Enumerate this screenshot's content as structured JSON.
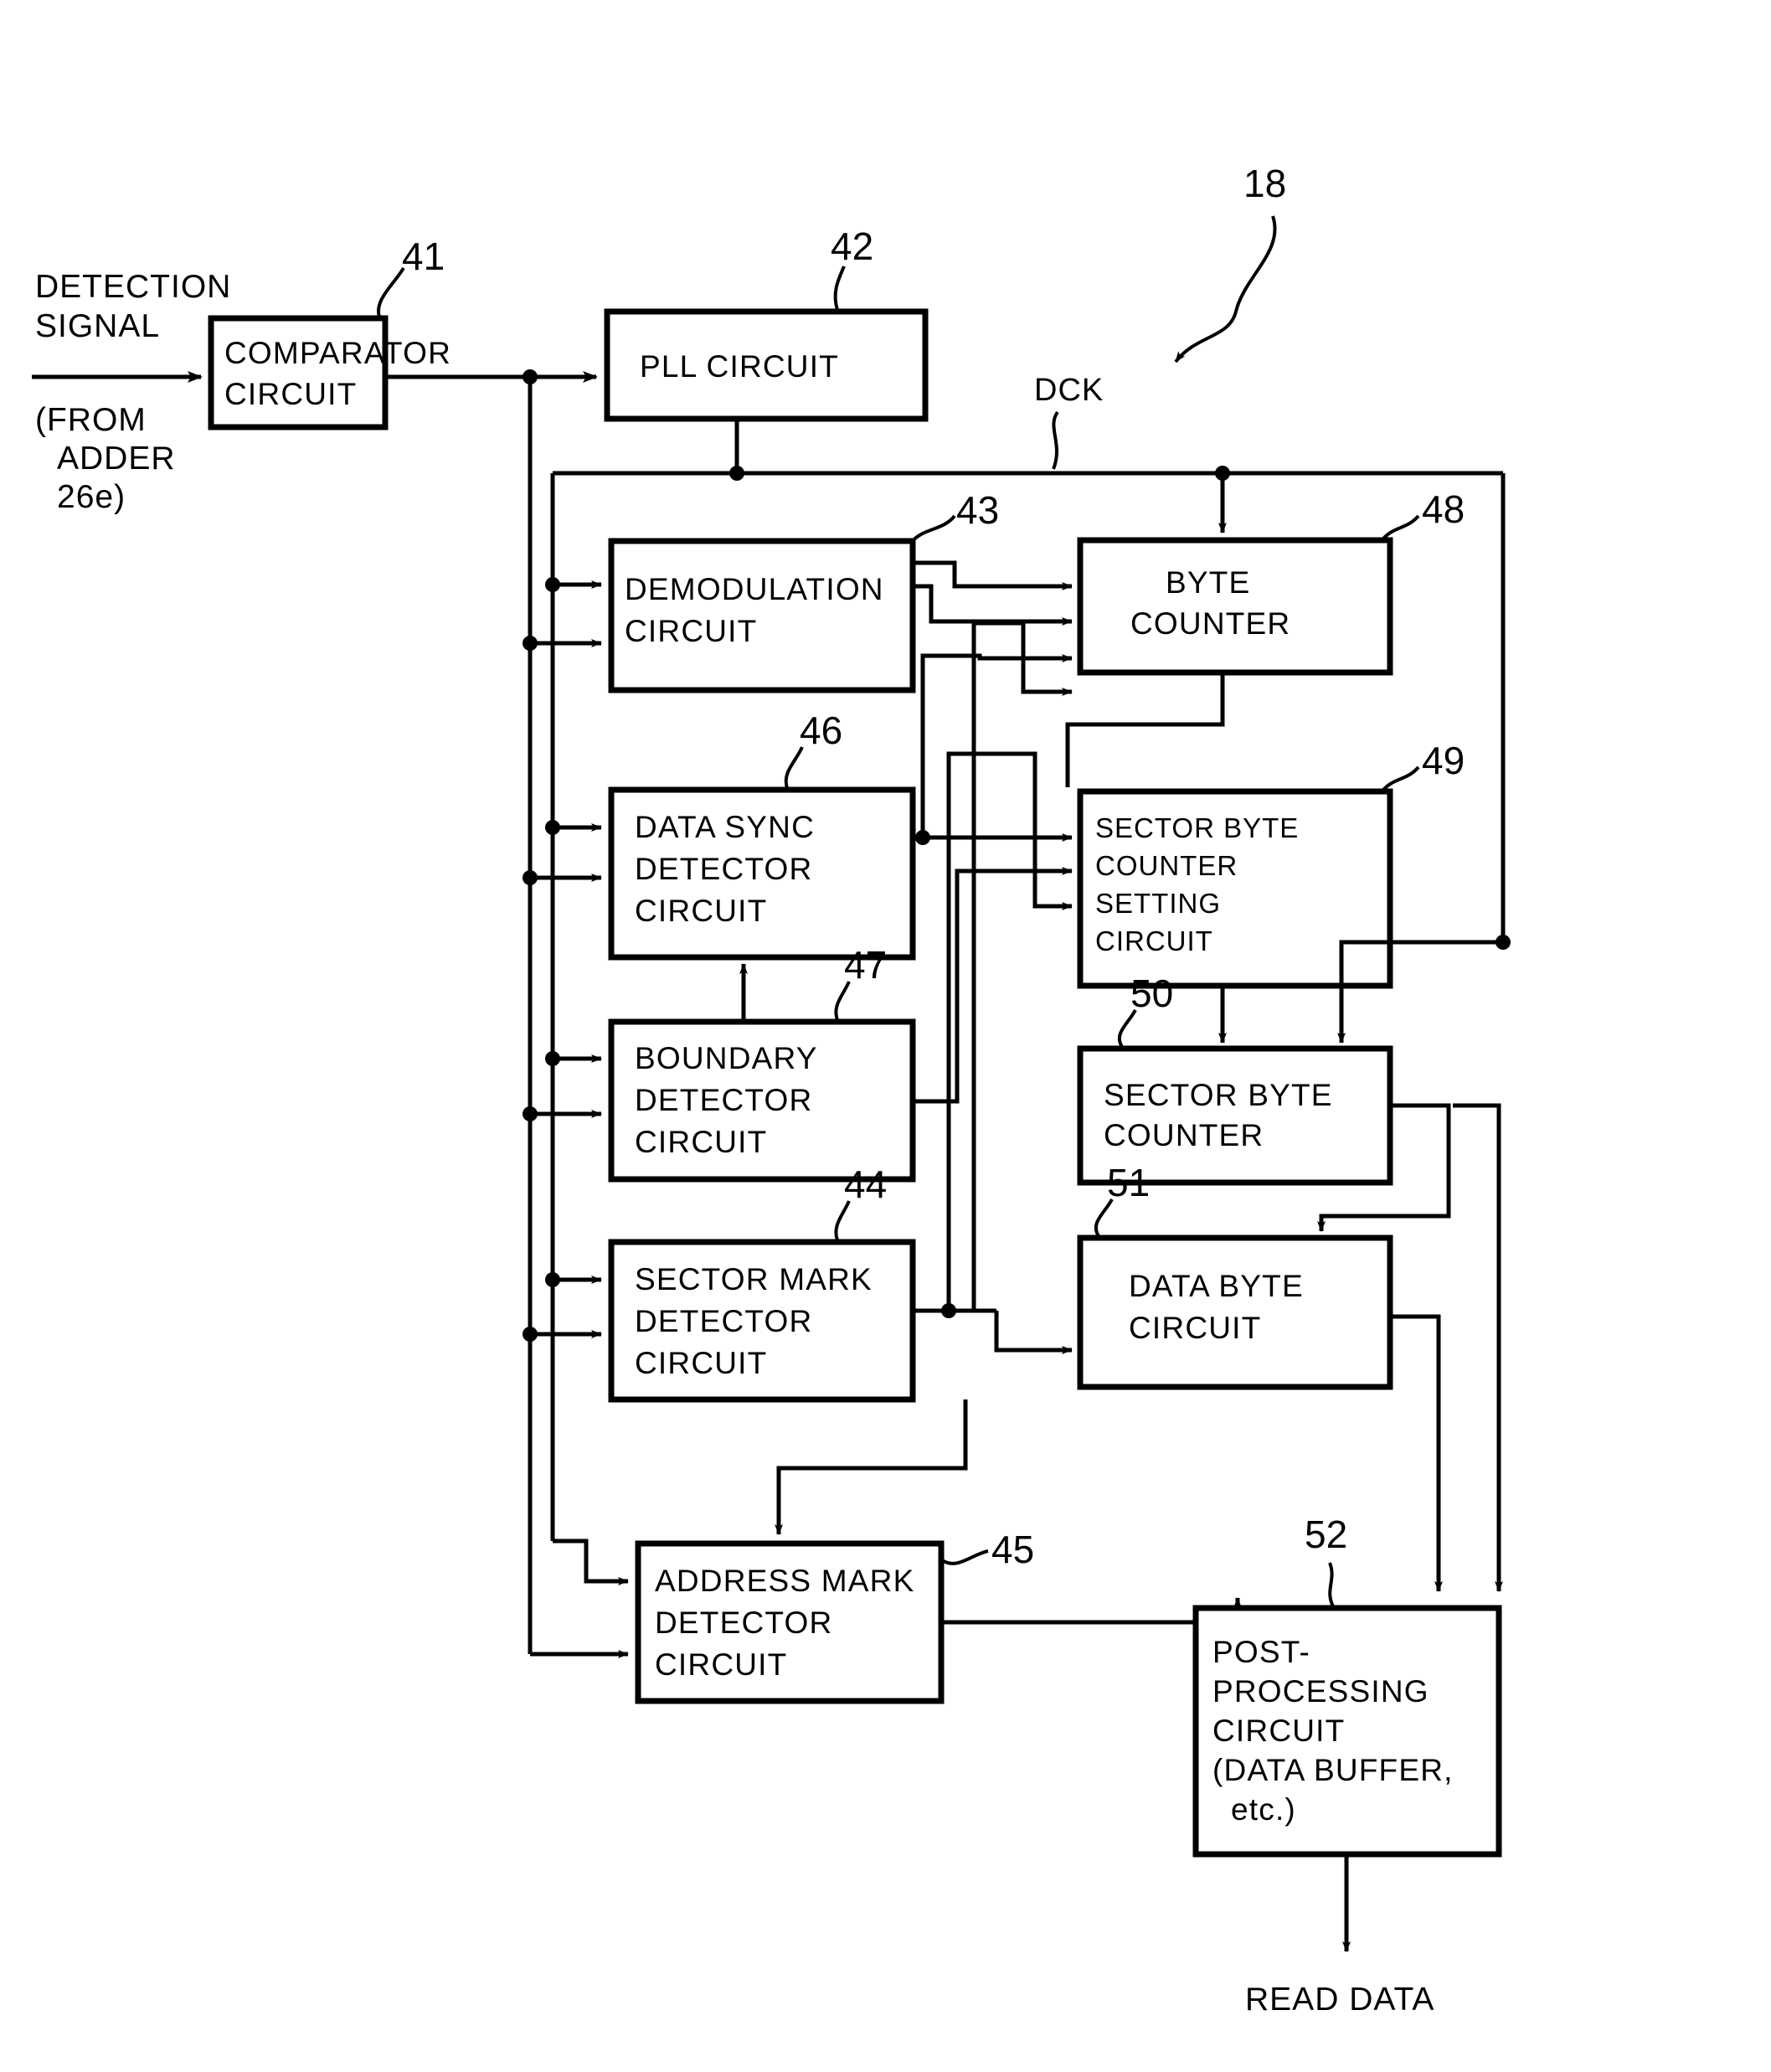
{
  "figure": {
    "type": "patent-block-diagram",
    "overall_reference": "18",
    "input_label_lines": [
      "DETECTION",
      "SIGNAL"
    ],
    "input_source_lines": [
      "(FROM",
      "ADDER",
      "26e)"
    ],
    "clock_label": "DCK",
    "output_label": "READ DATA"
  },
  "blocks": [
    {
      "id": "comparator",
      "ref": "41",
      "lines": [
        "COMPARATOR",
        "CIRCUIT"
      ]
    },
    {
      "id": "pll",
      "ref": "42",
      "lines": [
        "PLL CIRCUIT"
      ]
    },
    {
      "id": "demodulation",
      "ref": "43",
      "lines": [
        "DEMODULATION",
        "CIRCUIT"
      ]
    },
    {
      "id": "data-sync-detector",
      "ref": "46",
      "lines": [
        "DATA SYNC",
        "DETECTOR",
        "CIRCUIT"
      ]
    },
    {
      "id": "boundary-detector",
      "ref": "47",
      "lines": [
        "BOUNDARY",
        "DETECTOR",
        "CIRCUIT"
      ]
    },
    {
      "id": "sector-mark-detector",
      "ref": "44",
      "lines": [
        "SECTOR MARK",
        "DETECTOR",
        "CIRCUIT"
      ]
    },
    {
      "id": "address-mark-detector",
      "ref": "45",
      "lines": [
        "ADDRESS MARK",
        "DETECTOR",
        "CIRCUIT"
      ]
    },
    {
      "id": "byte-counter",
      "ref": "48",
      "lines": [
        "BYTE",
        "COUNTER"
      ]
    },
    {
      "id": "sector-byte-counter-setting",
      "ref": "49",
      "lines": [
        "SECTOR BYTE",
        "COUNTER",
        "SETTING",
        "CIRCUIT"
      ]
    },
    {
      "id": "sector-byte-counter",
      "ref": "50",
      "lines": [
        "SECTOR BYTE",
        "COUNTER"
      ]
    },
    {
      "id": "data-byte-circuit",
      "ref": "51",
      "lines": [
        "DATA BYTE",
        "CIRCUIT"
      ]
    },
    {
      "id": "post-processing",
      "ref": "52",
      "lines": [
        "POST-",
        "PROCESSING",
        "CIRCUIT",
        "(DATA BUFFER,",
        "etc.)"
      ]
    }
  ],
  "text": {
    "detection_1": "DETECTION",
    "detection_2": "SIGNAL",
    "from_1": "(FROM",
    "from_2": "ADDER",
    "from_3": "26e)",
    "dck": "DCK",
    "read_data": "READ DATA",
    "ref_41": "41",
    "ref_42": "42",
    "ref_43": "43",
    "ref_44": "44",
    "ref_45": "45",
    "ref_46": "46",
    "ref_47": "47",
    "ref_48": "48",
    "ref_49": "49",
    "ref_50": "50",
    "ref_51": "51",
    "ref_52": "52",
    "ref_18": "18",
    "comparator_1": "COMPARATOR",
    "comparator_2": "CIRCUIT",
    "pll_1": "PLL CIRCUIT",
    "demod_1": "DEMODULATION",
    "demod_2": "CIRCUIT",
    "datasync_1": "DATA SYNC",
    "datasync_2": "DETECTOR",
    "datasync_3": "CIRCUIT",
    "boundary_1": "BOUNDARY",
    "boundary_2": "DETECTOR",
    "boundary_3": "CIRCUIT",
    "sectormark_1": "SECTOR MARK",
    "sectormark_2": "DETECTOR",
    "sectormark_3": "CIRCUIT",
    "addrmark_1": "ADDRESS MARK",
    "addrmark_2": "DETECTOR",
    "addrmark_3": "CIRCUIT",
    "bytecounter_1": "BYTE",
    "bytecounter_2": "COUNTER",
    "sbcs_1": "SECTOR BYTE",
    "sbcs_2": "COUNTER",
    "sbcs_3": "SETTING",
    "sbcs_4": "CIRCUIT",
    "sbc_1": "SECTOR BYTE",
    "sbc_2": "COUNTER",
    "databyte_1": "DATA BYTE",
    "databyte_2": "CIRCUIT",
    "post_1": "POST-",
    "post_2": "PROCESSING",
    "post_3": "CIRCUIT",
    "post_4": "(DATA BUFFER,",
    "post_5": "etc.)"
  },
  "colors": {
    "ink": "#000000",
    "paper": "#ffffff"
  }
}
